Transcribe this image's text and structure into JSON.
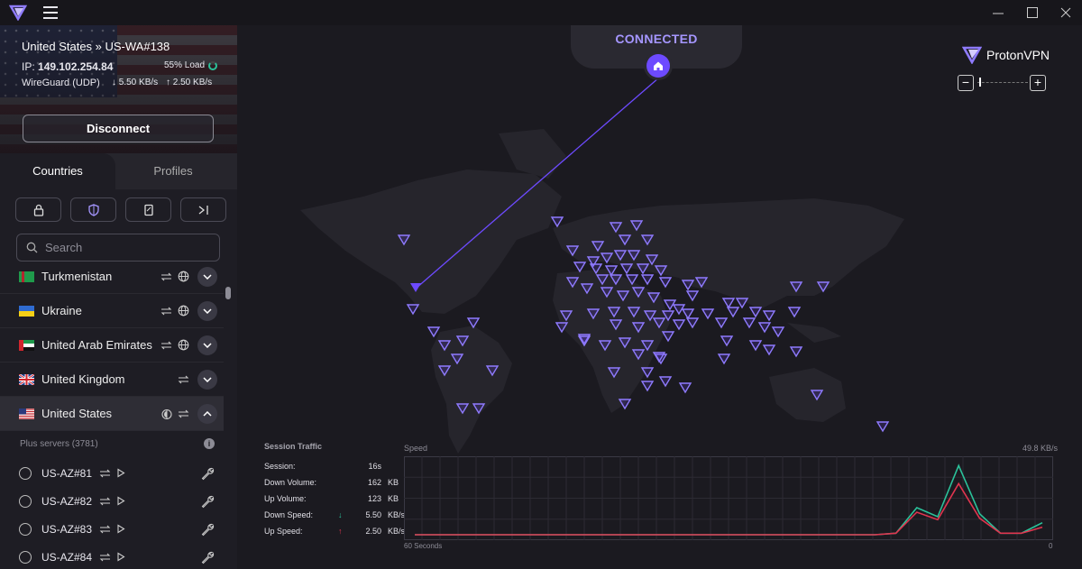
{
  "window": {
    "minimize": "—",
    "maximize": "☐",
    "close": "✕"
  },
  "connection": {
    "server": "United States » US-WA#138",
    "ip_label": "IP:",
    "ip": "149.102.254.84",
    "load": "55% Load",
    "load_fraction": 0.55,
    "protocol": "WireGuard (UDP)",
    "down_speed": "5.50 KB/s",
    "up_speed": "2.50 KB/s",
    "disconnect_label": "Disconnect"
  },
  "tabs": [
    {
      "label": "Countries",
      "active": true
    },
    {
      "label": "Profiles",
      "active": false
    }
  ],
  "search": {
    "placeholder": "Search"
  },
  "countries": [
    {
      "name": "Turkmenistan"
    },
    {
      "name": "Ukraine"
    },
    {
      "name": "United Arab Emirates"
    },
    {
      "name": "United Kingdom"
    },
    {
      "name": "United States",
      "expanded": true
    }
  ],
  "plus_servers_label": "Plus servers (3781)",
  "servers": [
    {
      "name": "US-AZ#81"
    },
    {
      "name": "US-AZ#82"
    },
    {
      "name": "US-AZ#83"
    },
    {
      "name": "US-AZ#84"
    }
  ],
  "map": {
    "status": "CONNECTED",
    "brand": "ProtonVPN",
    "accent": "#6d4aff",
    "teal": "#2bc29a"
  },
  "traffic": {
    "title": "Session Traffic",
    "rows": [
      {
        "label": "Session:",
        "value": "16s",
        "unit": ""
      },
      {
        "label": "Down Volume:",
        "value": "162",
        "unit": "KB"
      },
      {
        "label": "Up Volume:",
        "value": "123",
        "unit": "KB"
      },
      {
        "label": "Down Speed:",
        "value": "5.50",
        "unit": "KB/s",
        "arrow": "↓"
      },
      {
        "label": "Up Speed:",
        "value": "2.50",
        "unit": "KB/s",
        "arrow": "↑"
      }
    ],
    "speed_label": "Speed",
    "max_label": "49.8  KB/s",
    "x_left": "60 Seconds",
    "x_right": "0"
  },
  "chart_data": {
    "type": "line",
    "x": [
      60,
      58,
      56,
      54,
      52,
      50,
      48,
      46,
      44,
      42,
      40,
      38,
      36,
      34,
      32,
      30,
      28,
      26,
      24,
      22,
      20,
      18,
      16,
      14,
      12,
      10,
      8,
      6,
      4,
      2,
      0
    ],
    "series": [
      {
        "color": "#2bc29a",
        "values": [
          0,
          0,
          0,
          0,
          0,
          0,
          0,
          0,
          0,
          0,
          0,
          0,
          0,
          0,
          0,
          0,
          0,
          0,
          0,
          0,
          0,
          0,
          0,
          1,
          18,
          12,
          46,
          14,
          1,
          1,
          8
        ]
      },
      {
        "color": "#e0354f",
        "values": [
          0,
          0,
          0,
          0,
          0,
          0,
          0,
          0,
          0,
          0,
          0,
          0,
          0,
          0,
          0,
          0,
          0,
          0,
          0,
          0,
          0,
          0,
          0,
          1,
          15,
          10,
          34,
          11,
          1,
          1,
          5
        ]
      }
    ],
    "ylim": [
      0,
      49.8
    ]
  }
}
